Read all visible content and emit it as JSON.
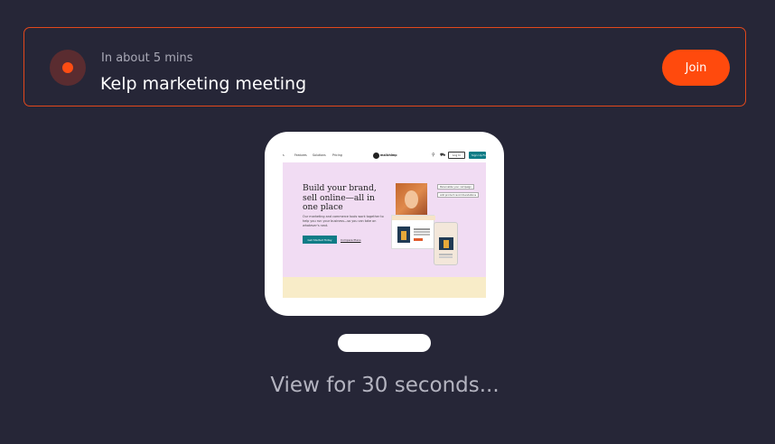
{
  "banner": {
    "when": "In about 5 mins",
    "title": "Kelp marketing meeting",
    "join_label": "Join",
    "record_icon": "record-dot-icon",
    "accent_color": "#ff4a0d"
  },
  "preview": {
    "nav": {
      "links": [
        "s",
        "Features",
        "Solutions",
        "Pricing"
      ],
      "logo_text": "mailchimp",
      "login_label": "Log In",
      "signup_label": "Sign Up Free"
    },
    "hero": {
      "headline": "Build your brand, sell online—all in one place",
      "body": "Our marketing and commerce tools work together to help you run your business—so you can take on whatever's next.",
      "primary_button": "Get Started Today",
      "secondary_link": "Compare Plans",
      "tags": [
        "Personalize your campaign",
        "Add product recommendations"
      ]
    }
  },
  "caption": "View for 30 seconds..."
}
